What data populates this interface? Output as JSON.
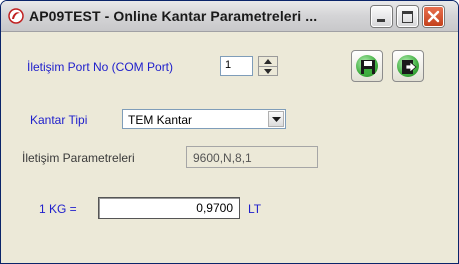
{
  "window": {
    "title": "AP09TEST - Online Kantar Parametreleri ...",
    "app_icon": "app-logo-icon",
    "controls": [
      "minimize-icon",
      "maximize-icon",
      "close-icon"
    ]
  },
  "form": {
    "port": {
      "label": "İletişim Port No (COM Port)",
      "value": "1"
    },
    "scale_type": {
      "label": "Kantar Tipi",
      "value": "TEM Kantar"
    },
    "comm_params": {
      "label": "İletişim Parametreleri",
      "value": "9600,N,8,1"
    },
    "conversion": {
      "label": "1 KG =",
      "value": "0,9700",
      "unit": "LT"
    }
  },
  "toolbar": {
    "save_icon": "floppy-disk-icon",
    "exit_icon": "exit-door-icon"
  },
  "colors": {
    "label_blue": "#2020cc",
    "close_red": "#c4411c",
    "button_green": "#3fae3f"
  }
}
